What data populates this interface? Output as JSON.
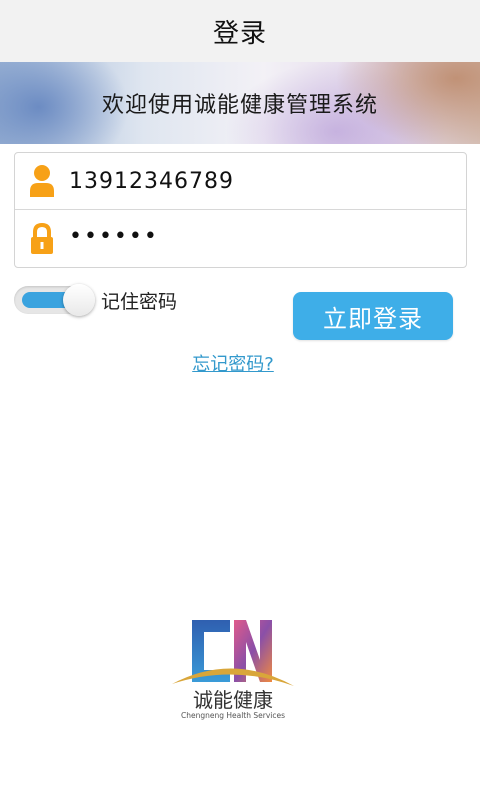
{
  "header": {
    "title": "登录"
  },
  "banner": {
    "text": "欢迎使用诚能健康管理系统"
  },
  "form": {
    "phone": {
      "value": "13912346789",
      "icon": "user-icon"
    },
    "password": {
      "value": "••••••",
      "icon": "lock-icon"
    }
  },
  "remember": {
    "label": "记住密码",
    "on": true
  },
  "login_button": {
    "label": "立即登录"
  },
  "forgot_link": {
    "label": "忘记密码?"
  },
  "logo": {
    "name": "诚能健康",
    "subtitle": "Chengneng Health Services"
  },
  "colors": {
    "accent": "#3eaee8",
    "icon_orange": "#f7a117",
    "link": "#3399cc"
  }
}
